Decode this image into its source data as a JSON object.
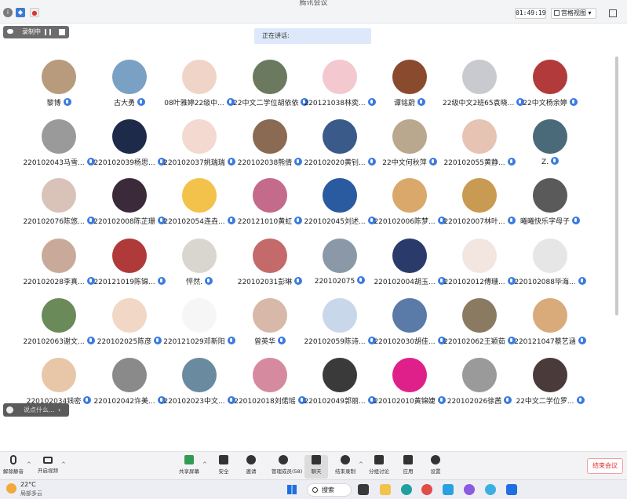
{
  "window": {
    "title": "腾讯会议",
    "clock": "01:49:19",
    "view_label": "宫格视图",
    "view_caret": "▾"
  },
  "recording": {
    "label": "录制中"
  },
  "speaking": {
    "label": "正在讲话:"
  },
  "mic_color": "#3a7be0",
  "participants": [
    {
      "name": "黎博",
      "avatar_color": "#b89a7c"
    },
    {
      "name": "古大勇",
      "avatar_color": "#7aa0c4"
    },
    {
      "name": "08叶雅婷22级中...",
      "avatar_color": "#f1d4c8"
    },
    {
      "name": "22中文二学位胡依依",
      "avatar_color": "#6b7a5e"
    },
    {
      "name": "220121038林奕...",
      "avatar_color": "#f3c8cf"
    },
    {
      "name": "谭铭蔚",
      "avatar_color": "#8a4a2e"
    },
    {
      "name": "22级中文2班65袁晓...",
      "avatar_color": "#c9c9d0"
    },
    {
      "name": "22中文杨余婷",
      "avatar_color": "#b33a3a"
    },
    {
      "name": "220102043马雪...",
      "avatar_color": "#9a9a9a"
    },
    {
      "name": "220102039杨思...",
      "avatar_color": "#1e2a4a"
    },
    {
      "name": "220102037姚瑞瑞",
      "avatar_color": "#f3d9cf"
    },
    {
      "name": "220102038熊倩",
      "avatar_color": "#8a6a52"
    },
    {
      "name": "220102020黄钊...",
      "avatar_color": "#3a5a8a"
    },
    {
      "name": "22中文何秋萍",
      "avatar_color": "#b9a78e"
    },
    {
      "name": "220102055黄静...",
      "avatar_color": "#e6c3b3"
    },
    {
      "name": "Z.",
      "avatar_color": "#4a6a7a"
    },
    {
      "name": "220102076陈悠...",
      "avatar_color": "#d9c2b8"
    },
    {
      "name": "220102008陈芷珊",
      "avatar_color": "#3a2a3a"
    },
    {
      "name": "220102054连垚...",
      "avatar_color": "#f2c24a"
    },
    {
      "name": "220121010黄虹",
      "avatar_color": "#c46a8a"
    },
    {
      "name": "220102045刘述...",
      "avatar_color": "#2a5aa0"
    },
    {
      "name": "220102006陈梦...",
      "avatar_color": "#d9a86a"
    },
    {
      "name": "220102007林叶...",
      "avatar_color": "#c99a52"
    },
    {
      "name": "曦曦快乐字母子",
      "avatar_color": "#5a5a5a"
    },
    {
      "name": "220102028李真...",
      "avatar_color": "#c9aa9a"
    },
    {
      "name": "220121019陈锦...",
      "avatar_color": "#b03a3a"
    },
    {
      "name": "怦然.",
      "avatar_color": "#d9d6cf"
    },
    {
      "name": "220102031彭琳",
      "avatar_color": "#c46a6a"
    },
    {
      "name": "220102075",
      "avatar_color": "#8a98a8"
    },
    {
      "name": "220102004胡玉...",
      "avatar_color": "#2a3a6a"
    },
    {
      "name": "220102012傅珊...",
      "avatar_color": "#f3e6e0"
    },
    {
      "name": "220102088毕海...",
      "avatar_color": "#e6e6e6"
    },
    {
      "name": "220102063谢文...",
      "avatar_color": "#6a8a5a"
    },
    {
      "name": "220102025陈彦",
      "avatar_color": "#f0d7c6"
    },
    {
      "name": "220121029邓新阳",
      "avatar_color": "#f6f6f6"
    },
    {
      "name": "曾英华",
      "avatar_color": "#d8b8a8"
    },
    {
      "name": "220102059陈诗...",
      "avatar_color": "#c8d8ea"
    },
    {
      "name": "220102030胡佳...",
      "avatar_color": "#5a7aa8"
    },
    {
      "name": "220102062王颖茹",
      "avatar_color": "#8a7a62"
    },
    {
      "name": "220121047蔡艺涵",
      "avatar_color": "#d9aa7a"
    },
    {
      "name": "220102034钱密",
      "avatar_color": "#e8c7a8"
    },
    {
      "name": "220102042许美...",
      "avatar_color": "#8a8a8a"
    },
    {
      "name": "220102023中文...",
      "avatar_color": "#6a8aa0"
    },
    {
      "name": "220102018刘偌瑶",
      "avatar_color": "#d68aa0"
    },
    {
      "name": "220102049郭丽...",
      "avatar_color": "#3a3a3a"
    },
    {
      "name": "220102010黄锦婕",
      "avatar_color": "#e0208a"
    },
    {
      "name": "220102026徐茜",
      "avatar_color": "#9a9a9a"
    },
    {
      "name": "22中文二学位罗...",
      "avatar_color": "#4a3a3a"
    }
  ],
  "chat": {
    "placeholder": "说点什么...",
    "collapse": "‹"
  },
  "toolbar": {
    "mute": "解除静音",
    "video": "开启视频",
    "share": "共享屏幕",
    "security": "安全",
    "invite": "邀请",
    "members": "管理成员(58)",
    "chat": "聊天",
    "end_record": "结束录制",
    "breakout": "分组讨论",
    "apps": "应用",
    "settings": "设置",
    "end_meeting": "结束会议",
    "caret": "^"
  },
  "taskbar": {
    "temperature": "22°C",
    "weather": "局部多云",
    "search": "搜索"
  }
}
